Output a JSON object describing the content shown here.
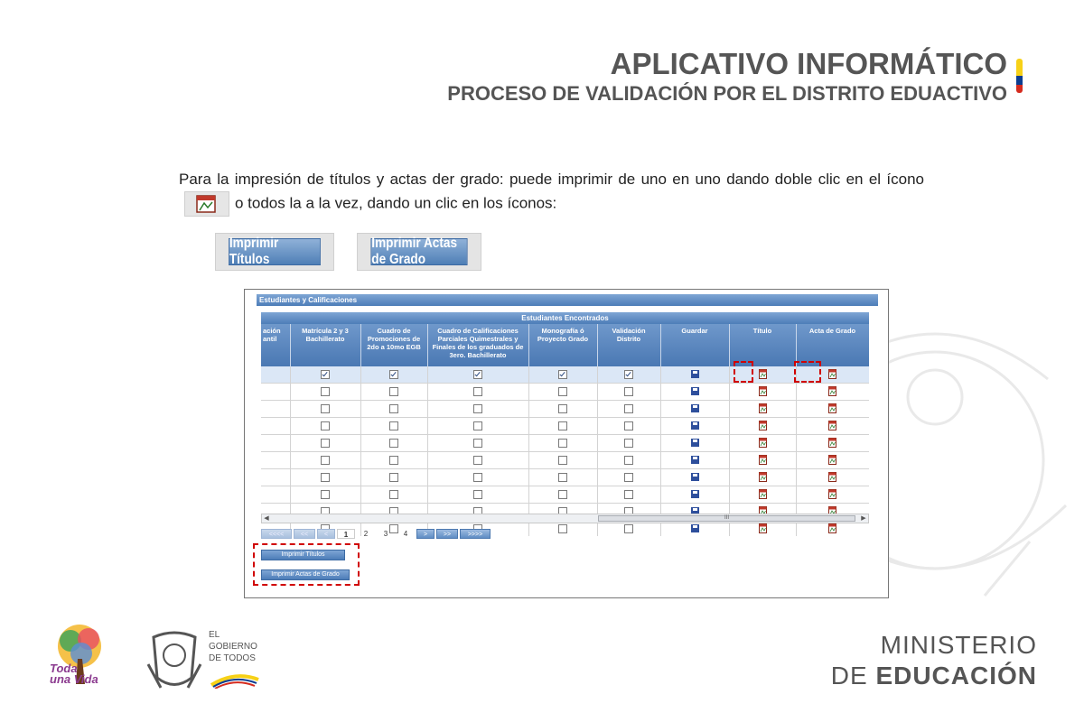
{
  "header": {
    "title": "APLICATIVO INFORMÁTICO",
    "subtitle": "PROCESO DE VALIDACIÓN POR EL DISTRITO EDUACTIVO"
  },
  "paragraph": {
    "part1": "Para la impresión de títulos y actas der grado: puede imprimir de uno en uno dando doble clic en el ícono",
    "part2": "o todos la a la vez, dando un clic en los íconos:"
  },
  "big_buttons": {
    "imprimir_titulos": "Imprimir Títulos",
    "imprimir_actas": "Imprimir Actas de Grado"
  },
  "panel": {
    "title": "Estudiantes y Calificaciones",
    "grid_title": "Estudiantes Encontrados",
    "columns": [
      "ación\nantil",
      "Matrícula 2 y 3 Bachillerato",
      "Cuadro de Promociones de 2do a 10mo EGB",
      "Cuadro de Calificaciones Parciales Quimestrales y Finales de los graduados de 3ero. Bachillerato",
      "Monografía ó Proyecto Grado",
      "Validación Distrito",
      "Guardar",
      "Título",
      "Acta de Grado"
    ],
    "scroll_thumb": "III",
    "pager": {
      "first": "<<<<",
      "prev_many": "<<",
      "prev": "<",
      "pages": [
        "1",
        "2",
        "3",
        "4"
      ],
      "active_page": "1",
      "next": ">",
      "next_many": ">>",
      "last": ">>>>"
    },
    "buttons": {
      "imprimir_titulos": "Imprimir Títulos",
      "imprimir_actas": "Imprimir Actas de Grado"
    }
  },
  "footer": {
    "toda_line1": "Toda",
    "toda_line2": "una Vida",
    "gobierno_line1": "EL",
    "gobierno_line2": "GOBIERNO",
    "gobierno_line3": "DE TODOS",
    "ministry_line1": "MINISTERIO",
    "ministry_line2a": "DE ",
    "ministry_line2b": "EDUCACIÓN"
  },
  "colors": {
    "accent_blue": "#4d7db8",
    "highlight_red": "#d00000",
    "flag_yellow": "#f7d117",
    "flag_blue": "#0b3d91",
    "flag_red": "#d52b1e"
  }
}
